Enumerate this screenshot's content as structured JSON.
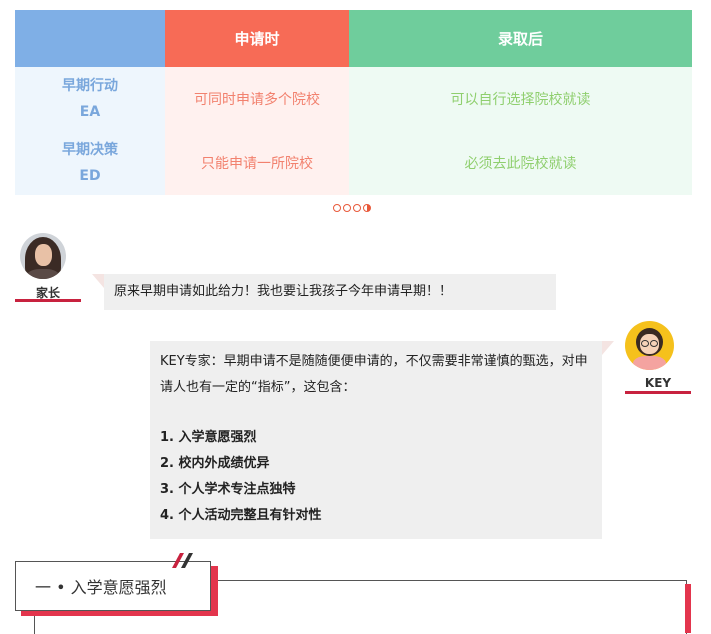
{
  "table": {
    "headers": [
      "",
      "申请时",
      "录取后"
    ],
    "rows": [
      {
        "type_cn": "早期行动",
        "type_abbr": "EA",
        "apply": "可同时申请多个院校",
        "after": "可以自行选择院校就读"
      },
      {
        "type_cn": "早期决策",
        "type_abbr": "ED",
        "apply": "只能申请一所院校",
        "after": "必须去此院校就读"
      }
    ]
  },
  "colors": {
    "header_blue": "#7fafe6",
    "header_red": "#f76b56",
    "header_green": "#6fcd9c",
    "accent_red": "#c8223f"
  },
  "chat": {
    "parent_label": "家长",
    "parent_message": "原来早期申请如此给力！我也要让我孩子今年申请早期！！",
    "key_label": "KEY",
    "key_intro": "KEY专家：早期申请不是随随便便申请的，不仅需要非常谨慎的甄选，对申请人也有一定的“指标”，这包含：",
    "key_points": [
      "1. 入学意愿强烈",
      "2. 校内外成绩优异",
      "3. 个人学术专注点独特",
      "4. 个人活动完整且有针对性"
    ]
  },
  "section": {
    "title": "一 • 入学意愿强烈"
  },
  "icons": {
    "carousel": "carousel-dots-icon",
    "parent_avatar": "parent-avatar-icon",
    "key_avatar": "key-expert-avatar-icon"
  }
}
